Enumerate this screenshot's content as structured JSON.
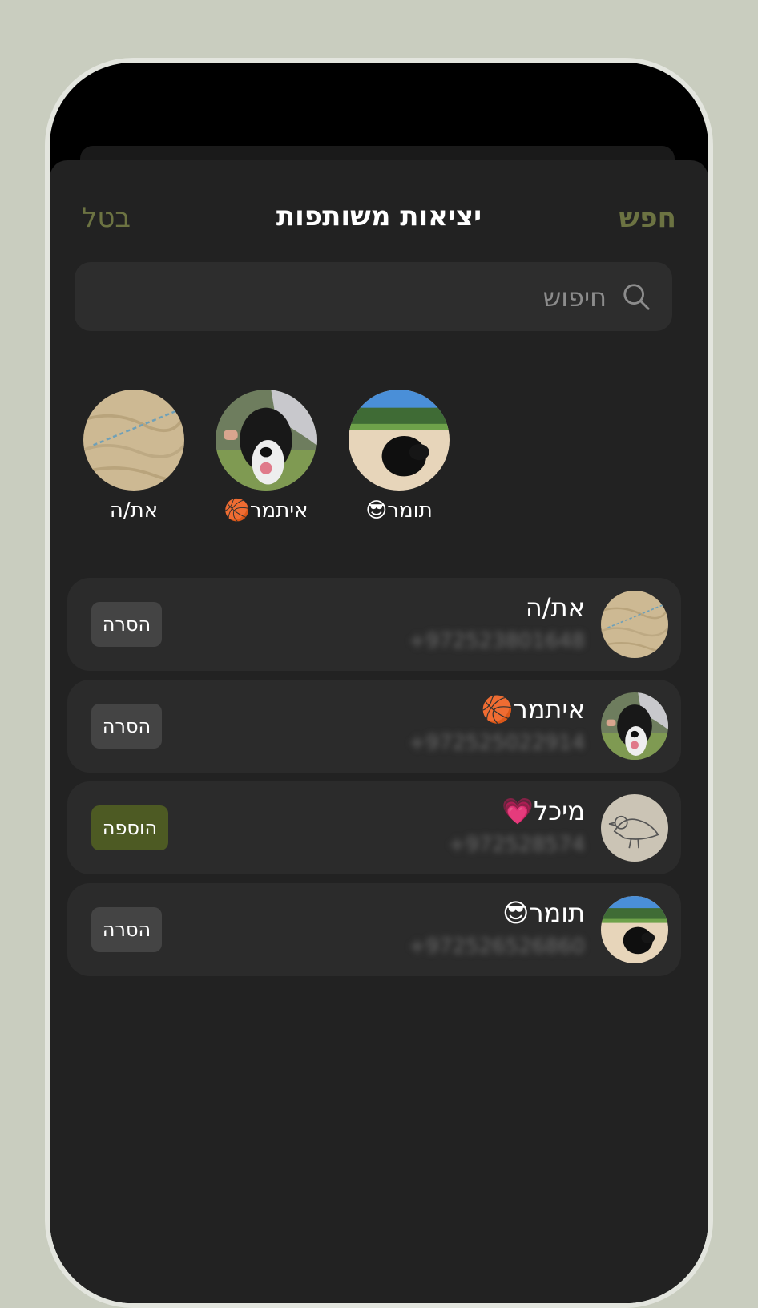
{
  "header": {
    "title": "יציאות משותפות",
    "search_button": "חפש",
    "cancel_button": "בטל"
  },
  "search": {
    "placeholder": "חיפוש",
    "value": ""
  },
  "selected": [
    {
      "name": "תומר😎",
      "avatar": "dog-on-lawn"
    },
    {
      "name": "איתמר🏀",
      "avatar": "dog-closeup"
    },
    {
      "name": "את/ה",
      "avatar": "sand"
    }
  ],
  "contacts": [
    {
      "name": "את/ה",
      "phone": "+972523801648",
      "action": "הסרה",
      "avatar": "sand"
    },
    {
      "name": "איתמר🏀",
      "phone": "+972525022914",
      "action": "הסרה",
      "avatar": "dog-closeup"
    },
    {
      "name": "מיכל💗",
      "phone": "+972528574",
      "action": "הוספה",
      "avatar": "bird-sketch"
    },
    {
      "name": "תומר😎",
      "phone": "+972526526860",
      "action": "הסרה",
      "avatar": "dog-on-lawn"
    }
  ],
  "colors": {
    "accent": "#6c7342",
    "add_button": "#4d5a23",
    "remove_button": "#444444",
    "background": "#222222"
  }
}
